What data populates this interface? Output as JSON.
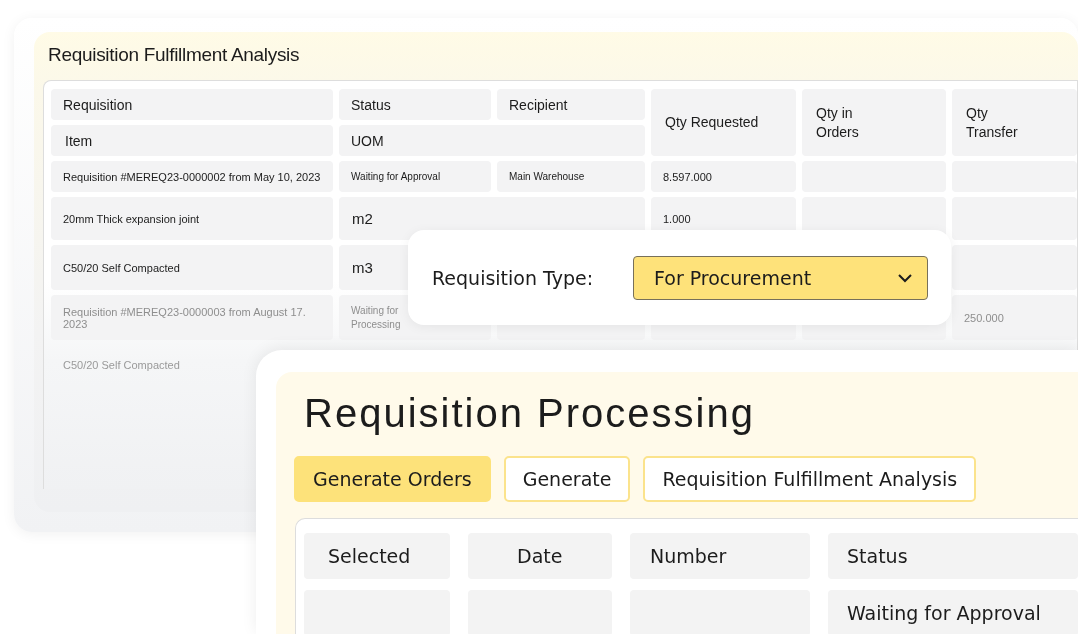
{
  "analysis_panel": {
    "title": "Requisition Fulfillment Analysis",
    "columns": [
      "Requisition",
      "Status",
      "Recipient",
      "Qty Requested",
      "Qty in Orders",
      "Qty Transfer"
    ],
    "sub_columns": [
      "Item",
      "UOM"
    ],
    "rows": [
      {
        "kind": "requisition",
        "muted": false,
        "requisition": "Requisition #MEREQ23-0000002 from May 10, 2023",
        "status": "Waiting for Approval",
        "recipient": "Main Warehouse",
        "qty_requested": "8.597.000"
      },
      {
        "kind": "item",
        "muted": false,
        "item": "20mm Thick expansion joint",
        "uom": "m2",
        "qty_requested": "1.000"
      },
      {
        "kind": "item",
        "muted": false,
        "item": "C50/20 Self Compacted",
        "uom": "m3"
      },
      {
        "kind": "requisition",
        "muted": true,
        "requisition": "Requisition #MEREQ23-0000003 from August 17. 2023",
        "status": "Waiting for Processing",
        "qty_transfer": "250.000"
      },
      {
        "kind": "item",
        "muted": true,
        "item": "C50/20 Self Compacted"
      }
    ]
  },
  "type_popup": {
    "label": "Requisition Type:",
    "value": "For Procurement"
  },
  "processing_panel": {
    "title": "Requisition Processing",
    "buttons": [
      {
        "label": "Generate Orders",
        "selected": true
      },
      {
        "label": "Generate",
        "selected": false
      },
      {
        "label": "Requisition Fulfillment Analysis",
        "selected": false
      }
    ],
    "columns": [
      "Selected",
      "Date",
      "Number",
      "Status"
    ],
    "rows": [
      {
        "status": "Waiting for Approval"
      }
    ]
  }
}
